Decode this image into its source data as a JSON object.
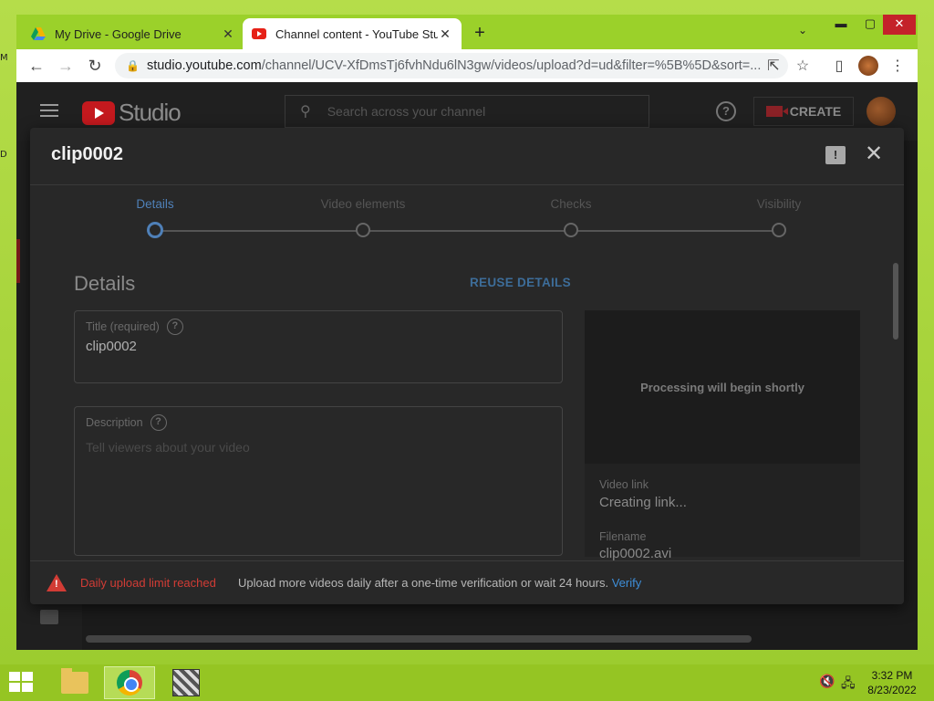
{
  "browser": {
    "tabs": [
      {
        "title": "My Drive - Google Drive",
        "icon": "google-drive-icon"
      },
      {
        "title": "Channel content - YouTube Studio",
        "icon": "youtube-icon",
        "active": true
      }
    ],
    "url_host": "studio.youtube.com",
    "url_path": "/channel/UCV-XfDmsTj6fvhNdu6lN3gw/videos/upload?d=ud&filter=%5B%5D&sort=..."
  },
  "studio": {
    "logo_text": "Studio",
    "search_placeholder": "Search across your channel",
    "create_label": "CREATE"
  },
  "modal": {
    "title": "clip0002",
    "steps": [
      {
        "label": "Details",
        "active": true
      },
      {
        "label": "Video elements"
      },
      {
        "label": "Checks"
      },
      {
        "label": "Visibility"
      }
    ],
    "section_heading": "Details",
    "reuse_label": "REUSE DETAILS",
    "title_field": {
      "label": "Title (required)",
      "value": "clip0002"
    },
    "description_field": {
      "label": "Description",
      "placeholder": "Tell viewers about your video"
    },
    "preview": {
      "processing_text": "Processing will begin shortly",
      "video_link_label": "Video link",
      "video_link_value": "Creating link...",
      "filename_label": "Filename",
      "filename_value": "clip0002.avi"
    },
    "limit": {
      "title": "Daily upload limit reached",
      "message": "Upload more videos daily after a one-time verification or wait 24 hours.",
      "verify_label": "Verify"
    }
  },
  "taskbar": {
    "time": "3:32 PM",
    "date": "8/23/2022"
  },
  "colors": {
    "accent_blue": "#3e8ed8",
    "warning_red": "#d23c35",
    "youtube_red": "#c4191e"
  }
}
